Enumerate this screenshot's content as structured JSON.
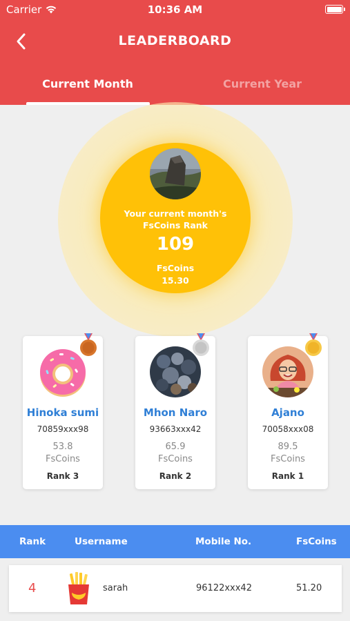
{
  "status_bar": {
    "carrier": "Carrier",
    "time": "10:36 AM"
  },
  "header": {
    "title": "LEADERBOARD"
  },
  "tabs": [
    {
      "label": "Current Month",
      "active": true
    },
    {
      "label": "Current Year",
      "active": false
    }
  ],
  "current_rank": {
    "caption_line1": "Your current month's",
    "caption_line2": "FsCoins Rank",
    "rank": "109",
    "coins_label": "FsCoins",
    "coins_value": "15.30"
  },
  "podium": [
    {
      "name": "Hinoka sumi",
      "mobile": "70859xxx98",
      "coins": "53.8",
      "coins_label": "FsCoins",
      "rank_label": "Rank 3",
      "medal": "bronze-medal-icon"
    },
    {
      "name": "Mhon Naro",
      "mobile": "93663xxx42",
      "coins": "65.9",
      "coins_label": "FsCoins",
      "rank_label": "Rank 2",
      "medal": "silver-medal-icon"
    },
    {
      "name": "Ajano",
      "mobile": "70058xxx08",
      "coins": "89.5",
      "coins_label": "FsCoins",
      "rank_label": "Rank 1",
      "medal": "gold-medal-icon"
    }
  ],
  "table": {
    "headers": {
      "rank": "Rank",
      "username": "Username",
      "mobile": "Mobile No.",
      "coins": "FsCoins"
    },
    "rows": [
      {
        "rank": "4",
        "username": "sarah",
        "mobile": "96122xxx42",
        "coins": "51.20",
        "avatar": "fries-icon"
      }
    ]
  },
  "colors": {
    "header": "#e84b4b",
    "rank_circle": "#ffc107",
    "accent_blue": "#2f7fd6",
    "table_header": "#4b8df0"
  }
}
